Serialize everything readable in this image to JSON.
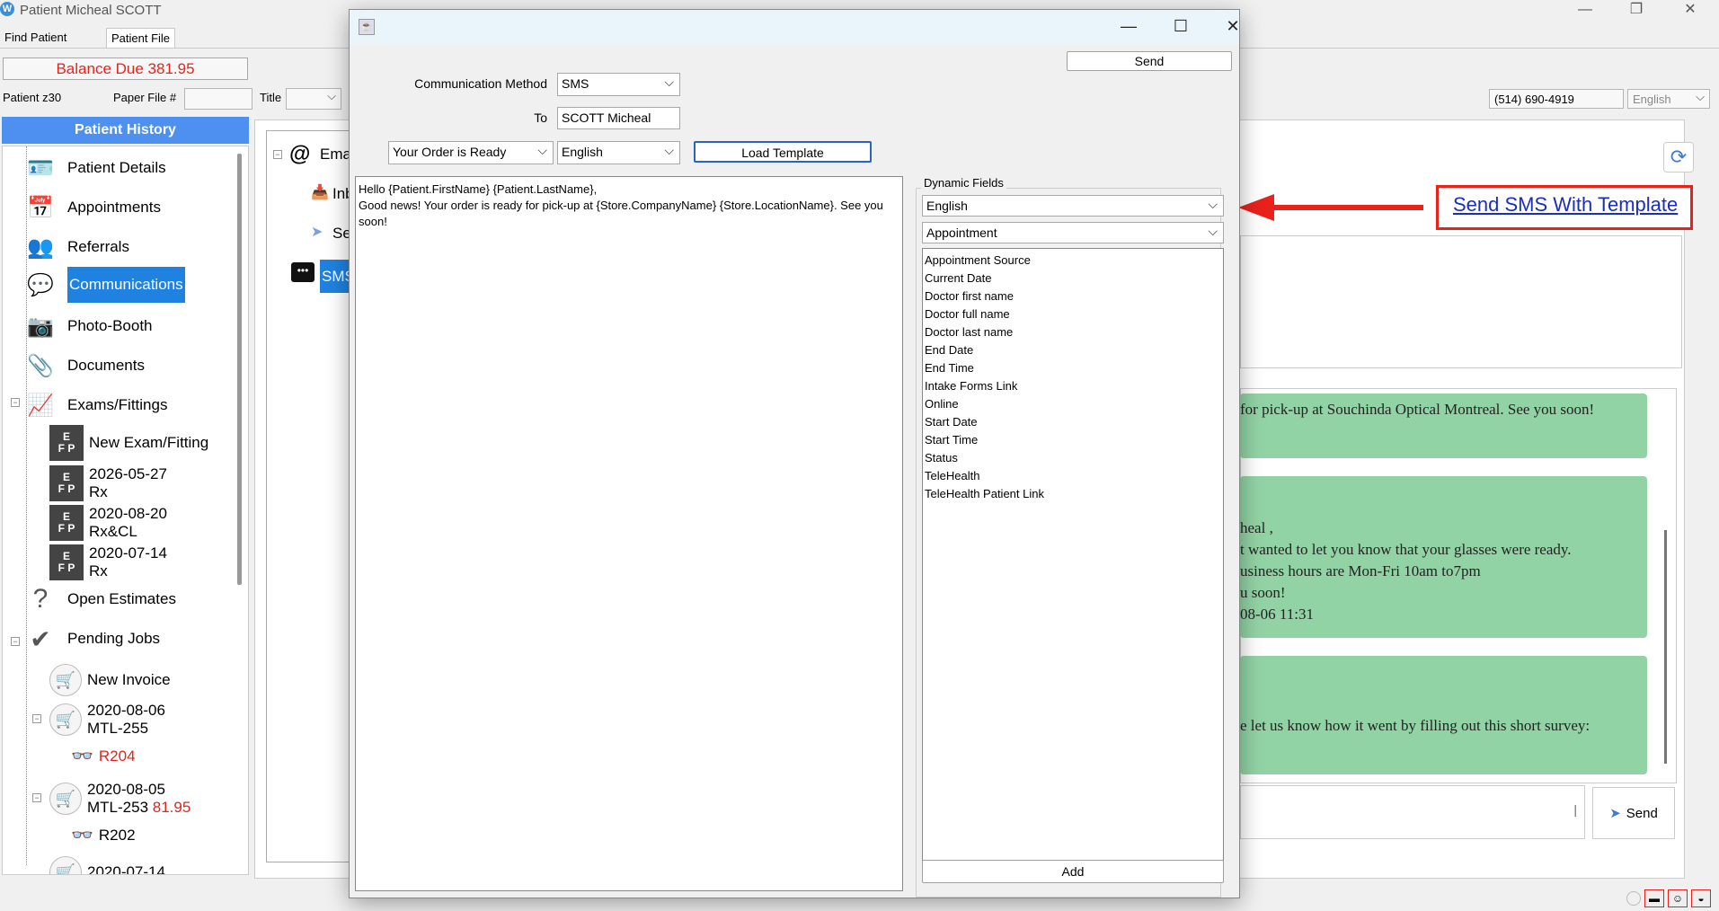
{
  "window": {
    "title": "Patient Micheal SCOTT",
    "logo_letter": "W",
    "minimize": "—",
    "maximize": "❐",
    "close": "✕"
  },
  "tabs": [
    "Find Patient",
    "Patient File"
  ],
  "balance": "Balance Due 381.95",
  "patient_bar": {
    "patient_id": "Patient z30",
    "paper_file_label": "Paper File #",
    "title_label": "Title",
    "phone": "(514) 690-4919",
    "language": "English"
  },
  "history": {
    "header": "Patient History",
    "items": [
      {
        "label": "Patient Details",
        "icon": "patient-details-icon"
      },
      {
        "label": "Appointments",
        "icon": "appointments-icon"
      },
      {
        "label": "Referrals",
        "icon": "referrals-icon"
      },
      {
        "label": "Communications",
        "icon": "communications-icon"
      },
      {
        "label": "Photo-Booth",
        "icon": "photo-booth-icon"
      },
      {
        "label": "Documents",
        "icon": "paperclip-icon"
      },
      {
        "label": "Exams/Fittings",
        "icon": "exam-chart-icon"
      }
    ],
    "exams": [
      {
        "line1": "New Exam/Fitting",
        "line2": ""
      },
      {
        "line1": "2026-05-27",
        "line2": "Rx"
      },
      {
        "line1": "2020-08-20",
        "line2": "Rx&CL"
      },
      {
        "line1": "2020-07-14",
        "line2": "Rx"
      }
    ],
    "open_estimates": "Open Estimates",
    "pending_jobs": "Pending Jobs",
    "new_invoice": "New Invoice",
    "invoices": [
      {
        "date": "2020-08-06",
        "code": "MTL-255",
        "amount": "",
        "sub": "R204"
      },
      {
        "date": "2020-08-05",
        "code": "MTL-253",
        "amount": "81.95",
        "sub": "R202"
      },
      {
        "date": "2020-07-14",
        "code": "",
        "amount": "",
        "sub": ""
      }
    ]
  },
  "comm_tree": {
    "email": "Ema",
    "inbox": "Inb",
    "sent": "Se",
    "sms": "SMS"
  },
  "messages": [
    {
      "lines": [
        "for pick-up at Souchinda Optical Montreal. See you soon!"
      ]
    },
    {
      "lines": [
        "heal ,",
        "t wanted to let you know that your glasses were ready.",
        "usiness hours are Mon-Fri 10am to7pm",
        "u soon!",
        "08-06 11:31"
      ]
    },
    {
      "lines": [
        "e let us know how it went by filling out this short survey:"
      ]
    }
  ],
  "reply": {
    "send_label": "Send",
    "cursor": "|"
  },
  "annotation": {
    "text": "Send SMS With Template",
    "color": "#e8221b"
  },
  "dialog": {
    "send_label": "Send",
    "method_label": "Communication Method",
    "method_value": "SMS",
    "to_label": "To",
    "to_value": "SCOTT Micheal",
    "template_value": "Your Order is Ready",
    "template_lang": "English",
    "load_template_label": "Load Template",
    "template_text": "Hello {Patient.FirstName} {Patient.LastName},\nGood news! Your order is ready for pick-up at {Store.CompanyName} {Store.LocationName}. See you soon!",
    "dynamic_fields_label": "Dynamic Fields",
    "dyn_lang": "English",
    "dyn_category": "Appointment",
    "dyn_fields": [
      "Appointment Source",
      "Current Date",
      "Doctor first name",
      "Doctor full name",
      "Doctor last name",
      "End Date",
      "End Time",
      "Intake Forms Link",
      "Online",
      "Start Date",
      "Start Time",
      "Status",
      "TeleHealth",
      "TeleHealth Patient Link"
    ],
    "add_label": "Add"
  },
  "colors": {
    "accent": "#1f82e0",
    "history_header": "#4d90f0",
    "bubble": "#92d3a5",
    "balance": "#e8221b"
  }
}
